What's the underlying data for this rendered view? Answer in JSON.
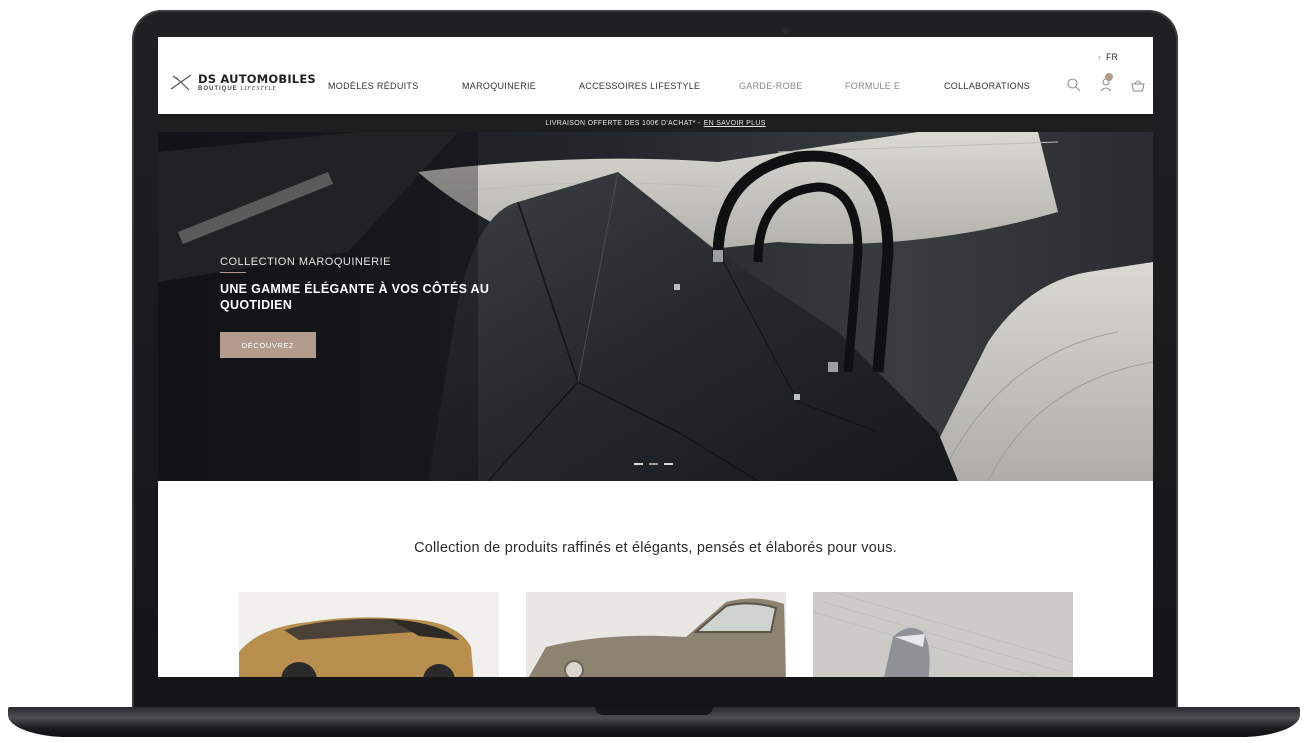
{
  "header": {
    "language": "FR",
    "logo": {
      "brand": "DS AUTOMOBILES",
      "sub_bold": "BOUTIQUE",
      "sub_script": "LIFESTYLE"
    },
    "nav": [
      {
        "label": "MODÈLES RÉDUITS"
      },
      {
        "label": "MAROQUINERIE"
      },
      {
        "label": "ACCESSOIRES LIFESTYLE"
      },
      {
        "label": "GARDE-ROBE"
      },
      {
        "label": "FORMULE E"
      },
      {
        "label": "COLLABORATIONS"
      }
    ],
    "icons": [
      "search-icon",
      "account-icon",
      "basket-icon"
    ]
  },
  "promo": {
    "text": "LIVRAISON OFFERTE DES 100€ D'ACHAT* -",
    "link": "EN SAVOIR PLUS"
  },
  "hero": {
    "eyebrow": "COLLECTION MAROQUINERIE",
    "title": "UNE GAMME ÉLÉGANTE À VOS CÔTÉS AU QUOTIDIEN",
    "button": "DÉCOUVREZ",
    "slides": 3,
    "active_slide": 2
  },
  "intro": {
    "text": "Collection de produits raffinés et élégants, pensés et élaborés pour vous."
  },
  "colors": {
    "accent": "#b29a8d",
    "promo_bg": "#1e1e1e",
    "text": "#2b2b2b"
  }
}
